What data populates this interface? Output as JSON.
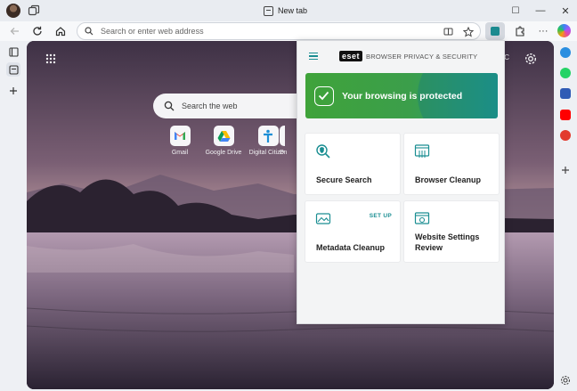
{
  "browser": {
    "tab_title": "New tab",
    "address_placeholder": "Search or enter web address",
    "window_controls": {
      "minimize": "—",
      "maximize": "☐",
      "close": "✕"
    },
    "more_label": "···"
  },
  "new_tab": {
    "search_placeholder": "Search the web",
    "weather_text": "°C",
    "shortcuts": [
      {
        "label": "Gmail",
        "icon": "gmail-icon"
      },
      {
        "label": "Google Drive",
        "icon": "google-drive-icon"
      },
      {
        "label": "Digital Citizen",
        "icon": "digital-citizen-icon"
      },
      {
        "label": "D",
        "icon": "unknown-site-icon"
      }
    ]
  },
  "eset_popup": {
    "logo_badge": "eset",
    "product_name": "BROWSER PRIVACY & SECURITY",
    "status_text": "Your browsing is protected",
    "cards": [
      {
        "label": "Secure Search",
        "tag": "",
        "icon": "secure-search-icon"
      },
      {
        "label": "Browser Cleanup",
        "tag": "",
        "icon": "browser-cleanup-icon"
      },
      {
        "label": "Metadata Cleanup",
        "tag": "SET UP",
        "icon": "metadata-cleanup-icon"
      },
      {
        "label": "Website Settings Review",
        "tag": "",
        "icon": "website-settings-icon"
      }
    ]
  },
  "colors": {
    "eset_teal": "#1a8e92",
    "banner_green": "#3fa33a",
    "banner_teal": "#1f9a8b"
  }
}
